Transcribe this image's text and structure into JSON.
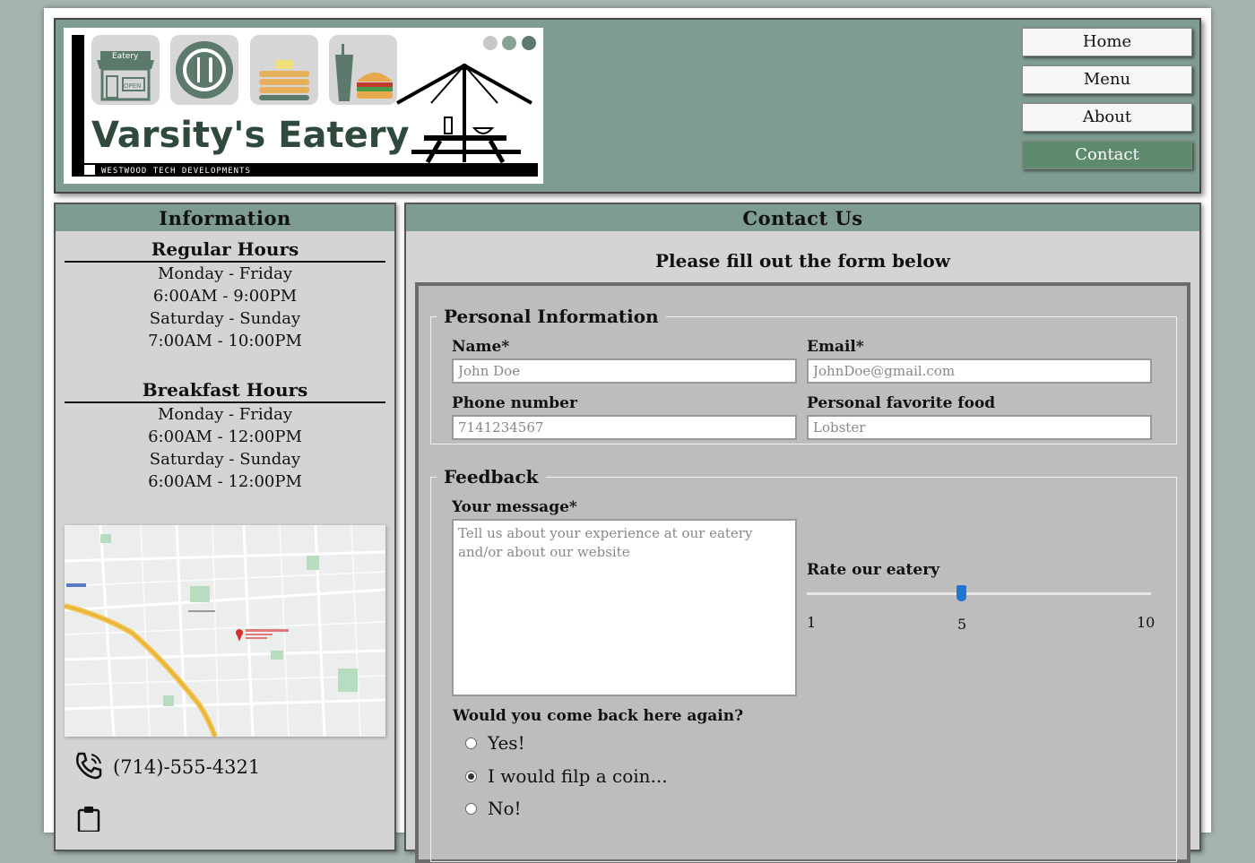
{
  "logo": {
    "brand_name": "Varsity's Eatery",
    "tagline": "WESTWOOD TECH DEVELOPMENTS",
    "store_sign": "Eatery",
    "store_door": "OPEN"
  },
  "nav": {
    "items": [
      {
        "label": "Home",
        "active": false
      },
      {
        "label": "Menu",
        "active": false
      },
      {
        "label": "About",
        "active": false
      },
      {
        "label": "Contact",
        "active": true
      }
    ]
  },
  "info": {
    "title": "Information",
    "regular": {
      "heading": "Regular Hours",
      "weekday": "Monday - Friday",
      "weekday_hours": "6:00AM - 9:00PM",
      "weekend": "Saturday - Sunday",
      "weekend_hours": "7:00AM - 10:00PM"
    },
    "breakfast": {
      "heading": "Breakfast Hours",
      "weekday": "Monday - Friday",
      "weekday_hours": "6:00AM - 12:00PM",
      "weekend": "Saturday - Sunday",
      "weekend_hours": "6:00AM - 12:00PM"
    },
    "phone": "(714)-555-4321"
  },
  "contact": {
    "title": "Contact Us",
    "subtitle": "Please fill out the form below",
    "personal": {
      "legend": "Personal Information",
      "name_label": "Name*",
      "name_placeholder": "John Doe",
      "email_label": "Email*",
      "email_placeholder": "JohnDoe@gmail.com",
      "phone_label": "Phone number",
      "phone_placeholder": "7141234567",
      "food_label": "Personal favorite food",
      "food_placeholder": "Lobster"
    },
    "feedback": {
      "legend": "Feedback",
      "message_label": "Your message*",
      "message_placeholder": "Tell us about your experience at our eatery and/or about our website",
      "rate_label": "Rate our eatery",
      "rate_min": "1",
      "rate_mid": "5",
      "rate_max": "10",
      "rate_value": 5,
      "return_question": "Would you come back here again?",
      "options": [
        {
          "label": "Yes!",
          "checked": false
        },
        {
          "label": "I would filp a coin...",
          "checked": true
        },
        {
          "label": "No!",
          "checked": false
        }
      ]
    }
  },
  "colors": {
    "sage": "#7f9c90",
    "active_nav": "#5e8a6e",
    "panel": "#d4d4d4",
    "slider": "#1f76d2"
  }
}
